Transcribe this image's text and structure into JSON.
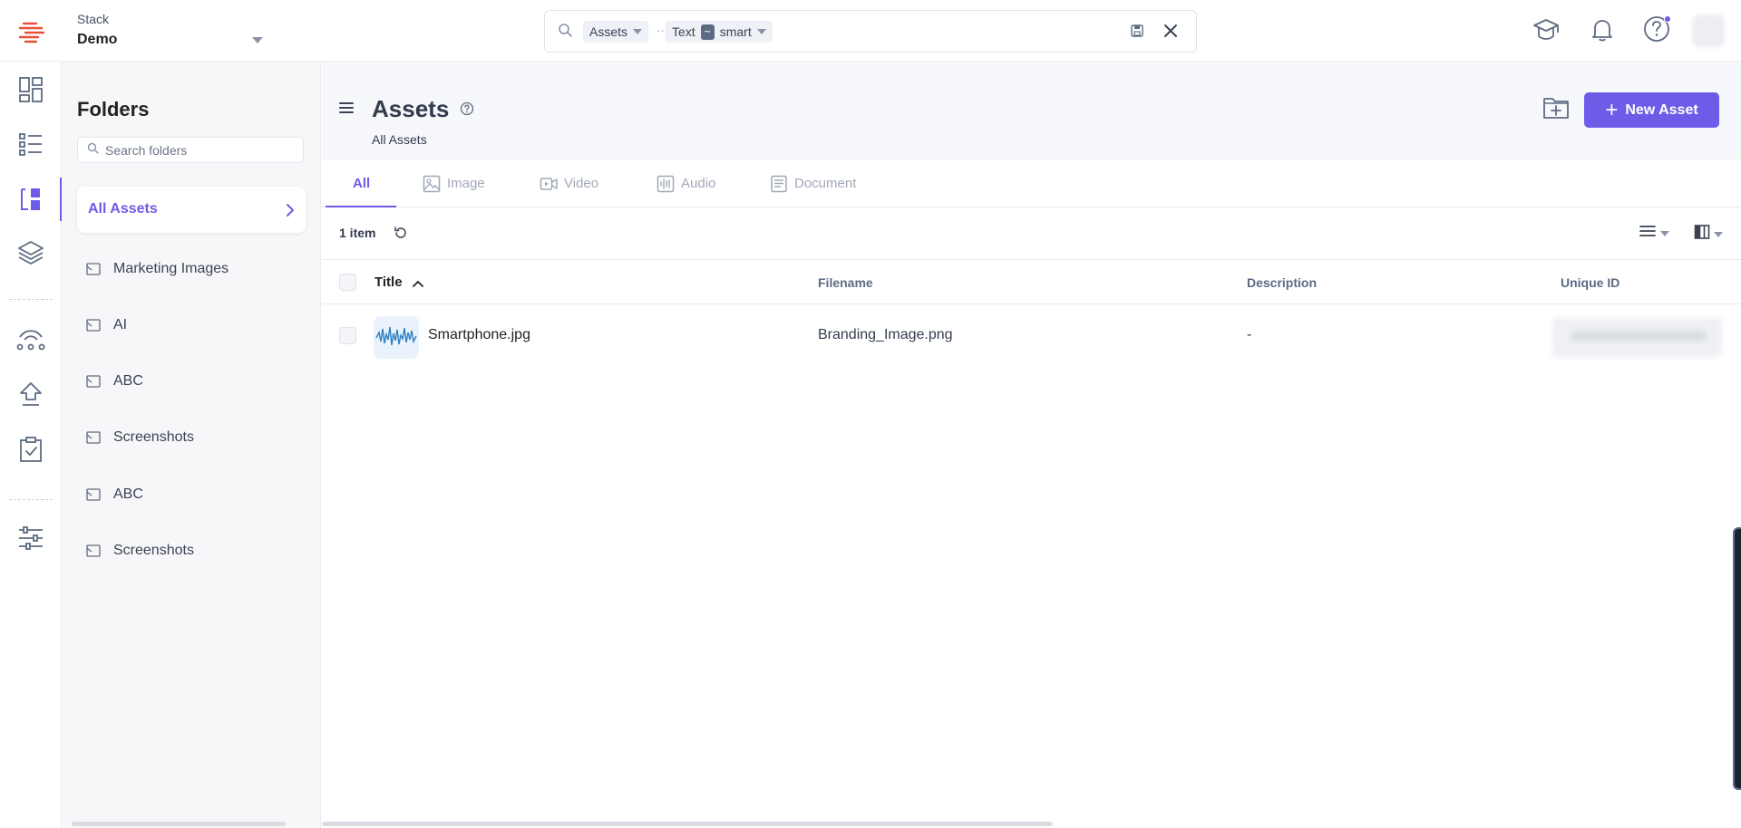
{
  "topbar": {
    "stack_label": "Stack",
    "stack_name": "Demo",
    "search": {
      "chip_module": "Assets",
      "chip_field": "Text",
      "operator": "~",
      "chip_value": "smart",
      "ellipsis": "···"
    },
    "icons": [
      "academy-icon",
      "bell-icon",
      "help-icon"
    ]
  },
  "leftnav": {
    "items": [
      "dashboard-icon",
      "entries-icon",
      "assets-icon",
      "stacks-icon",
      "releases-icon",
      "deploy-icon",
      "tasks-icon",
      "settings-icon"
    ],
    "active": "assets-icon"
  },
  "folders": {
    "title": "Folders",
    "search_placeholder": "Search folders",
    "all_assets_label": "All Assets",
    "items": [
      {
        "label": "Marketing Images"
      },
      {
        "label": "AI"
      },
      {
        "label": "ABC"
      },
      {
        "label": "Screenshots"
      },
      {
        "label": "ABC"
      },
      {
        "label": "Screenshots"
      }
    ]
  },
  "main": {
    "title": "Assets",
    "breadcrumb": "All Assets",
    "new_asset_label": "New Asset",
    "tabs": [
      {
        "label": "All",
        "icon": ""
      },
      {
        "label": "Image",
        "icon": "image-icon"
      },
      {
        "label": "Video",
        "icon": "video-icon"
      },
      {
        "label": "Audio",
        "icon": "audio-icon"
      },
      {
        "label": "Document",
        "icon": "document-icon"
      }
    ],
    "item_count": "1 item",
    "columns": {
      "title": "Title",
      "filename": "Filename",
      "description": "Description",
      "unique_id": "Unique ID"
    },
    "rows": [
      {
        "title": "Smartphone.jpg",
        "filename": "Branding_Image.png",
        "description": "-"
      }
    ]
  },
  "colors": {
    "accent": "#6c5ce7",
    "logo": "#e8503a"
  }
}
